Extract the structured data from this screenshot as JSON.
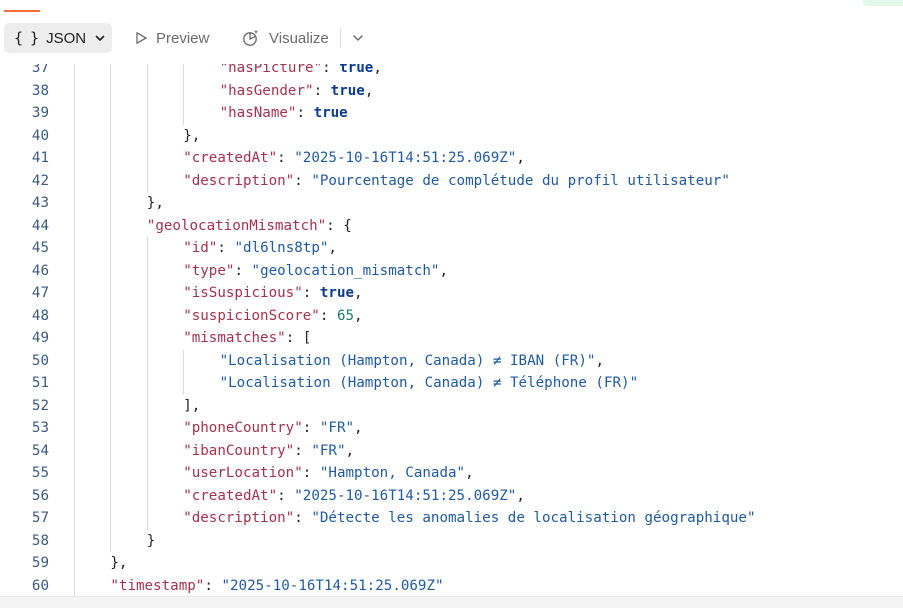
{
  "toolbar": {
    "format_label": "JSON",
    "format_icon": "braces-icon",
    "format_braces": "{ }",
    "preview_label": "Preview",
    "visualize_label": "Visualize",
    "accent_color": "#ff6c37"
  },
  "editor": {
    "lines": [
      {
        "n": "37",
        "indent": 4,
        "parts": [
          {
            "t": "\"hasPicture\"",
            "c": "k"
          },
          {
            "t": ": ",
            "c": "p"
          },
          {
            "t": "true",
            "c": "b"
          },
          {
            "t": ",",
            "c": "p"
          }
        ]
      },
      {
        "n": "38",
        "indent": 4,
        "parts": [
          {
            "t": "\"hasGender\"",
            "c": "k"
          },
          {
            "t": ": ",
            "c": "p"
          },
          {
            "t": "true",
            "c": "b"
          },
          {
            "t": ",",
            "c": "p"
          }
        ]
      },
      {
        "n": "39",
        "indent": 4,
        "parts": [
          {
            "t": "\"hasName\"",
            "c": "k"
          },
          {
            "t": ": ",
            "c": "p"
          },
          {
            "t": "true",
            "c": "b"
          }
        ]
      },
      {
        "n": "40",
        "indent": 3,
        "parts": [
          {
            "t": "},",
            "c": "p"
          }
        ]
      },
      {
        "n": "41",
        "indent": 3,
        "parts": [
          {
            "t": "\"createdAt\"",
            "c": "k"
          },
          {
            "t": ": ",
            "c": "p"
          },
          {
            "t": "\"2025-10-16T14:51:25.069Z\"",
            "c": "s"
          },
          {
            "t": ",",
            "c": "p"
          }
        ]
      },
      {
        "n": "42",
        "indent": 3,
        "parts": [
          {
            "t": "\"description\"",
            "c": "k"
          },
          {
            "t": ": ",
            "c": "p"
          },
          {
            "t": "\"Pourcentage de complétude du profil utilisateur\"",
            "c": "s"
          }
        ]
      },
      {
        "n": "43",
        "indent": 2,
        "parts": [
          {
            "t": "},",
            "c": "p"
          }
        ]
      },
      {
        "n": "44",
        "indent": 2,
        "parts": [
          {
            "t": "\"geolocationMismatch\"",
            "c": "k"
          },
          {
            "t": ": {",
            "c": "p"
          }
        ]
      },
      {
        "n": "45",
        "indent": 3,
        "parts": [
          {
            "t": "\"id\"",
            "c": "k"
          },
          {
            "t": ": ",
            "c": "p"
          },
          {
            "t": "\"dl6lns8tp\"",
            "c": "s"
          },
          {
            "t": ",",
            "c": "p"
          }
        ]
      },
      {
        "n": "46",
        "indent": 3,
        "parts": [
          {
            "t": "\"type\"",
            "c": "k"
          },
          {
            "t": ": ",
            "c": "p"
          },
          {
            "t": "\"geolocation_mismatch\"",
            "c": "s"
          },
          {
            "t": ",",
            "c": "p"
          }
        ]
      },
      {
        "n": "47",
        "indent": 3,
        "parts": [
          {
            "t": "\"isSuspicious\"",
            "c": "k"
          },
          {
            "t": ": ",
            "c": "p"
          },
          {
            "t": "true",
            "c": "b"
          },
          {
            "t": ",",
            "c": "p"
          }
        ]
      },
      {
        "n": "48",
        "indent": 3,
        "parts": [
          {
            "t": "\"suspicionScore\"",
            "c": "k"
          },
          {
            "t": ": ",
            "c": "p"
          },
          {
            "t": "65",
            "c": "n"
          },
          {
            "t": ",",
            "c": "p"
          }
        ]
      },
      {
        "n": "49",
        "indent": 3,
        "parts": [
          {
            "t": "\"mismatches\"",
            "c": "k"
          },
          {
            "t": ": [",
            "c": "p"
          }
        ]
      },
      {
        "n": "50",
        "indent": 4,
        "parts": [
          {
            "t": "\"Localisation (Hampton, Canada) ≠ IBAN (FR)\"",
            "c": "s"
          },
          {
            "t": ",",
            "c": "p"
          }
        ]
      },
      {
        "n": "51",
        "indent": 4,
        "parts": [
          {
            "t": "\"Localisation (Hampton, Canada) ≠ Téléphone (FR)\"",
            "c": "s"
          }
        ]
      },
      {
        "n": "52",
        "indent": 3,
        "parts": [
          {
            "t": "],",
            "c": "p"
          }
        ]
      },
      {
        "n": "53",
        "indent": 3,
        "parts": [
          {
            "t": "\"phoneCountry\"",
            "c": "k"
          },
          {
            "t": ": ",
            "c": "p"
          },
          {
            "t": "\"FR\"",
            "c": "s"
          },
          {
            "t": ",",
            "c": "p"
          }
        ]
      },
      {
        "n": "54",
        "indent": 3,
        "parts": [
          {
            "t": "\"ibanCountry\"",
            "c": "k"
          },
          {
            "t": ": ",
            "c": "p"
          },
          {
            "t": "\"FR\"",
            "c": "s"
          },
          {
            "t": ",",
            "c": "p"
          }
        ]
      },
      {
        "n": "55",
        "indent": 3,
        "parts": [
          {
            "t": "\"userLocation\"",
            "c": "k"
          },
          {
            "t": ": ",
            "c": "p"
          },
          {
            "t": "\"Hampton, Canada\"",
            "c": "s"
          },
          {
            "t": ",",
            "c": "p"
          }
        ]
      },
      {
        "n": "56",
        "indent": 3,
        "parts": [
          {
            "t": "\"createdAt\"",
            "c": "k"
          },
          {
            "t": ": ",
            "c": "p"
          },
          {
            "t": "\"2025-10-16T14:51:25.069Z\"",
            "c": "s"
          },
          {
            "t": ",",
            "c": "p"
          }
        ]
      },
      {
        "n": "57",
        "indent": 3,
        "parts": [
          {
            "t": "\"description\"",
            "c": "k"
          },
          {
            "t": ": ",
            "c": "p"
          },
          {
            "t": "\"Détecte les anomalies de localisation géographique\"",
            "c": "s"
          }
        ]
      },
      {
        "n": "58",
        "indent": 2,
        "parts": [
          {
            "t": "}",
            "c": "p"
          }
        ]
      },
      {
        "n": "59",
        "indent": 1,
        "parts": [
          {
            "t": "},",
            "c": "p"
          }
        ]
      },
      {
        "n": "60",
        "indent": 1,
        "parts": [
          {
            "t": "\"timestamp\"",
            "c": "k"
          },
          {
            "t": ": ",
            "c": "p"
          },
          {
            "t": "\"2025-10-16T14:51:25.069Z\"",
            "c": "s"
          }
        ]
      }
    ]
  }
}
